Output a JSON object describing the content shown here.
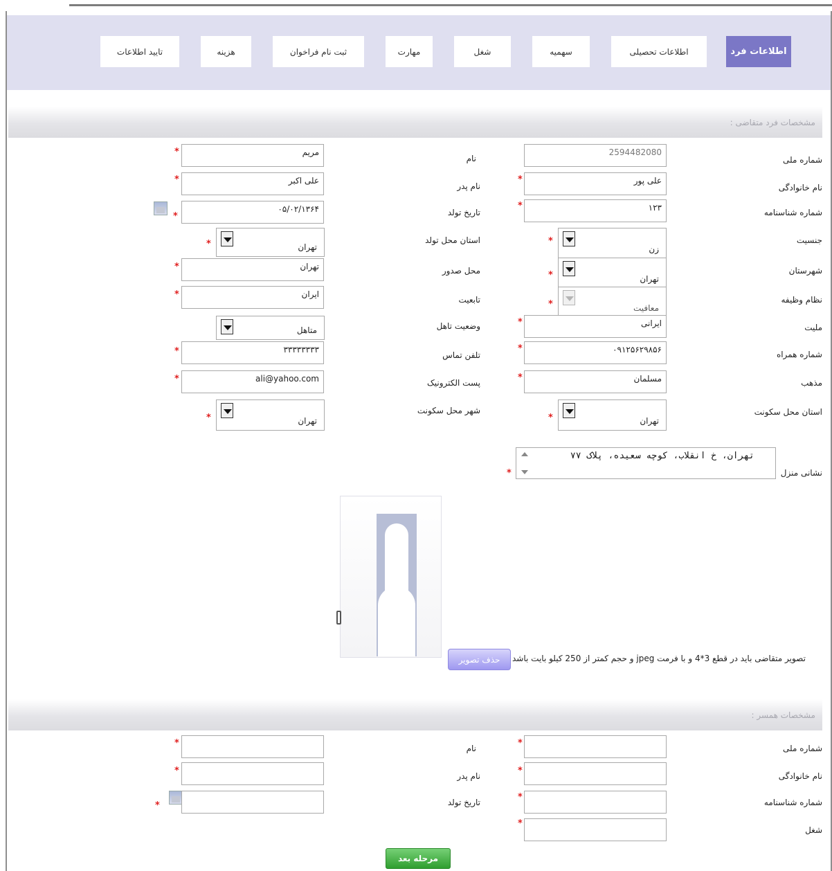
{
  "tabs": [
    {
      "label": "اطلاعات فرد",
      "active": true
    },
    {
      "label": "اطلاعات تحصیلی"
    },
    {
      "label": "سهمیه"
    },
    {
      "label": "شغل"
    },
    {
      "label": "مهارت"
    },
    {
      "label": "ثبت نام فراخوان"
    },
    {
      "label": "هزینه"
    },
    {
      "label": "تایید اطلاعات"
    }
  ],
  "applicant": {
    "section_title": "مشخصات فرد متقاضی :",
    "labels": {
      "national_id": "شماره ملی",
      "last_name": "نام خانوادگی",
      "id_number": "شماره شناسنامه",
      "gender": "جنسیت",
      "city": "شهرستان",
      "military": "نظام وظیفه",
      "nationality": "ملیت",
      "mobile": "شماره همراه",
      "religion": "مذهب",
      "residence_province": "استان محل سکونت",
      "address": "نشانی منزل",
      "first_name": "نام",
      "father_name": "نام پدر",
      "birth_date": "تاریخ تولد",
      "birth_province": "استان محل تولد",
      "issue_place": "محل صدور",
      "citizenship": "تابعیت",
      "marital": "وضعیت تاهل",
      "phone": "تلفن تماس",
      "email": "پست الکترونیک",
      "residence_city": "شهر محل سکونت"
    },
    "values": {
      "national_id": "2594482080",
      "last_name": "علی پور",
      "id_number": "۱۲۳",
      "gender": "زن",
      "city": "تهران",
      "military": "معافیت",
      "nationality": "ایرانی",
      "mobile": "۰۹۱۲۵۶۲۹۸۵۶",
      "religion": "مسلمان",
      "residence_province": "تهران",
      "address": "تهران، خ انقلاب، کوچه سعیده، پلاک ۷۷",
      "first_name": "مریم",
      "father_name": "علی اکبر",
      "birth_date": "۰۵/۰۲/۱۳۶۴",
      "birth_province": "تهران",
      "issue_place": "تهران",
      "citizenship": "ایران",
      "marital": "متاهل",
      "phone": "۳۳۳۳۳۳۳۳",
      "email": "ali@yahoo.com",
      "residence_city": "تهران"
    },
    "photo_note": "تصویر متقاضی باید در قطع 3*4 و با فرمت jpeg و حجم کمتر از 250 کیلو بایت باشد",
    "delete_photo_label": "حذف تصویر"
  },
  "spouse": {
    "section_title": "مشخصات همسر :",
    "labels": {
      "national_id": "شماره ملی",
      "last_name": "نام خانوادگی",
      "id_number": "شماره شناسنامه",
      "job": "شغل",
      "first_name": "نام",
      "father_name": "نام پدر",
      "birth_date": "تاریخ تولد"
    }
  },
  "next_button_label": "مرحله بعد",
  "required_mark": "*"
}
